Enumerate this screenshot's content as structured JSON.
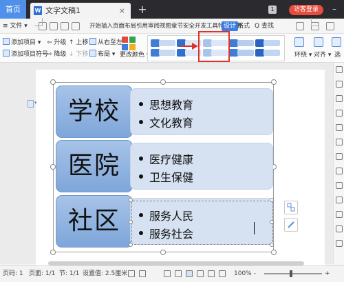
{
  "titlebar": {
    "home_tab": "首页",
    "doc_tab": "文字文稿1",
    "doc_tab_close": "×",
    "new_tab": "+",
    "tab_count": "1",
    "login": "访客登录",
    "minimize": "–"
  },
  "menubar": {
    "file": "≡ 文件 ▾",
    "items_text": "开始插入页面布局引用审阅视图章节安全开发工具特色应用",
    "design": "设计",
    "format": "格式",
    "search": "Q 查找"
  },
  "ribbon": {
    "add_item": "添加项目 ▾",
    "add_bullet": "添加项目符号",
    "promote": "升级",
    "demote": "降级",
    "move_up": "上移",
    "move_down": "下移",
    "right_to_left": "从右至左",
    "layout": "布局 ▾",
    "change_color": "更改颜色 ▾",
    "wrap": "环绕 ▾",
    "align": "对齐 ▾",
    "select": "选"
  },
  "smartart": {
    "rows": [
      {
        "main": "学校",
        "bullets": [
          "思想教育",
          "文化教育"
        ]
      },
      {
        "main": "医院",
        "bullets": [
          "医疗健康",
          "卫生保健"
        ]
      },
      {
        "main": "社区",
        "bullets": [
          "服务人民",
          "服务社会"
        ]
      }
    ]
  },
  "statusbar": {
    "page_number": "页码: 1",
    "pages": "页面: 1/1",
    "section": "节: 1/1",
    "setting": "设置值: 2.5厘米",
    "zoom": "100% -",
    "zoom_plus": "+"
  },
  "colors": {
    "accent": "#3b7ee0",
    "highlight": "#e1322a",
    "shape_main": "#8fb2df",
    "shape_sub": "#d6e2f2"
  }
}
